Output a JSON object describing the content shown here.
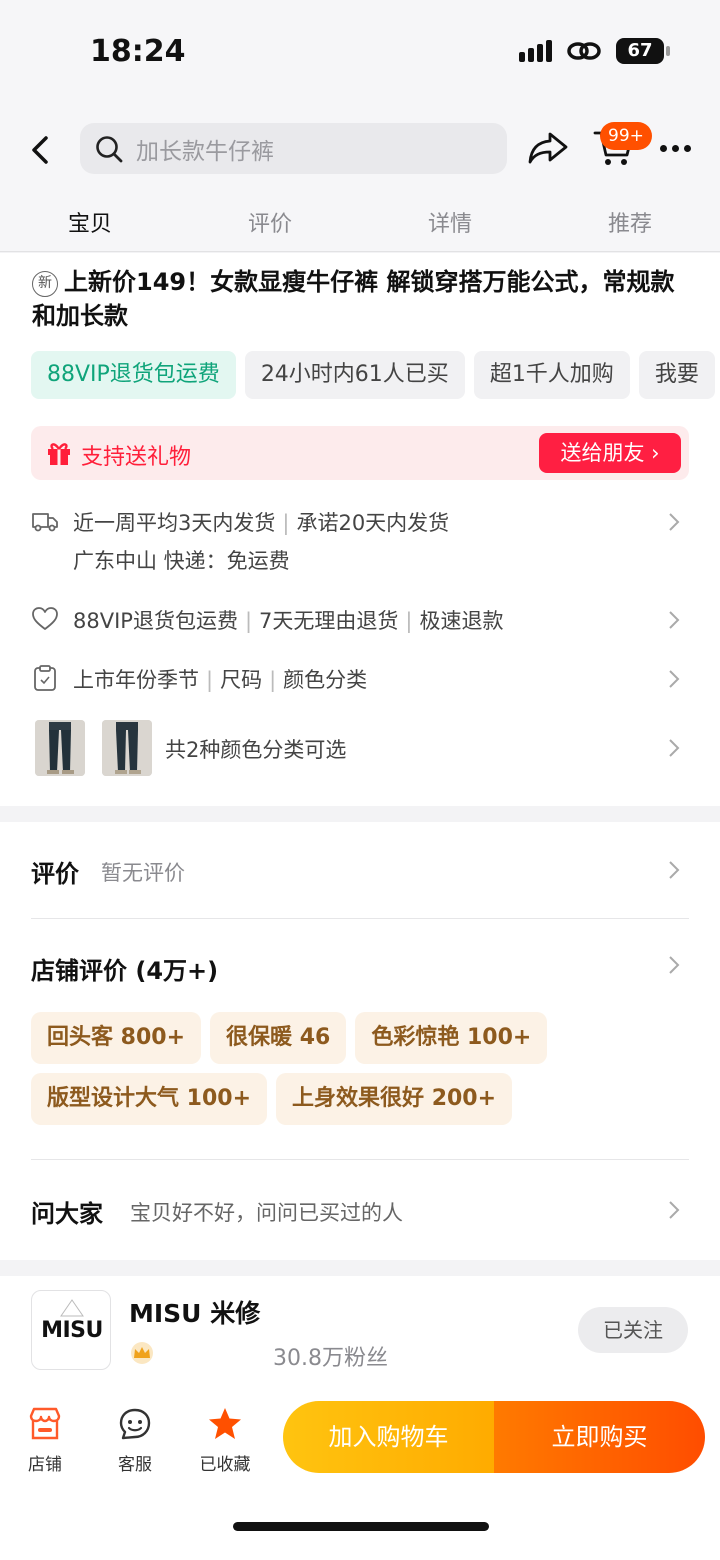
{
  "status": {
    "time": "18:24",
    "battery": "67"
  },
  "search": {
    "placeholder": "加长款牛仔裤"
  },
  "cart": {
    "badge": "99+"
  },
  "tabs": [
    {
      "label": "宝贝"
    },
    {
      "label": "评价"
    },
    {
      "label": "详情"
    },
    {
      "label": "推荐"
    }
  ],
  "product": {
    "new_badge": "新",
    "title": "上新价149！女款显瘦牛仔裤 解锁穿搭万能公式，常规款和加长款",
    "chips": [
      {
        "label": "88VIP退货包运费"
      },
      {
        "label": "24小时内61人已买"
      },
      {
        "label": "超1千人加购"
      },
      {
        "label": "我要"
      }
    ]
  },
  "gift": {
    "label": "支持送礼物",
    "button": "送给朋友 ›"
  },
  "shipping": {
    "line1": "近一周平均3天内发货",
    "line1b": "承诺20天内发货",
    "line2": "广东中山  快递：免运费"
  },
  "service": {
    "items": [
      "88VIP退货包运费",
      "7天无理由退货",
      "极速退款"
    ]
  },
  "params": {
    "items": [
      "上市年份季节",
      "尺码",
      "颜色分类"
    ]
  },
  "colors": {
    "text": "共2种颜色分类可选"
  },
  "reviews": {
    "title": "评价",
    "sub": "暂无评价"
  },
  "shop_reviews": {
    "title": "店铺评价 (4万+)",
    "tags": [
      {
        "label": "回头客 800+"
      },
      {
        "label": "很保暖 46"
      },
      {
        "label": "色彩惊艳 100+"
      },
      {
        "label": "版型设计大气 100+"
      },
      {
        "label": "上身效果很好 200+"
      }
    ]
  },
  "qa": {
    "title": "问大家",
    "sub": "宝贝好不好，问问已买过的人"
  },
  "shop": {
    "logo": "MISU",
    "name": "MISU 米修",
    "fans": "30.8万粉丝",
    "follow": "已关注"
  },
  "bottom": {
    "shop": "店铺",
    "service": "客服",
    "fav": "已收藏",
    "add_cart": "加入购物车",
    "buy": "立即购买"
  },
  "accent": {
    "orange": "#ff5000",
    "red": "#ff1f42",
    "green": "#0fa47a",
    "gold": "#ffc410"
  }
}
